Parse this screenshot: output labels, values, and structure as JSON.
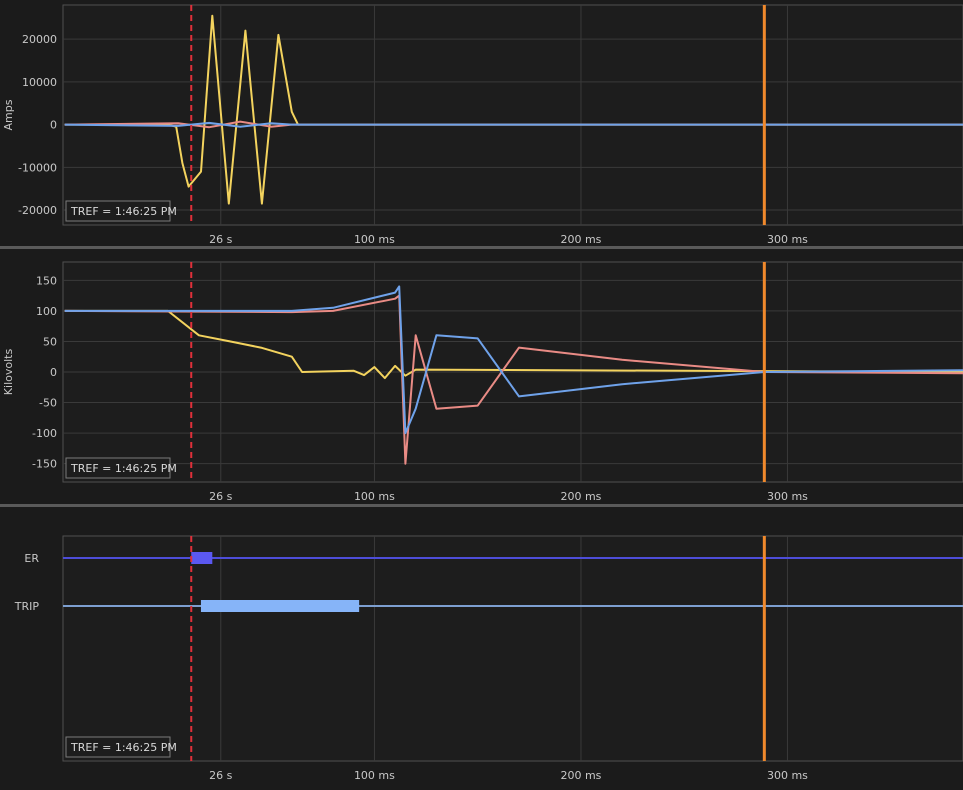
{
  "tref_label": "TREF = 1:46:25 PM",
  "colors": {
    "background": "#1b1b1b",
    "phase_a": "#f3d35e",
    "phase_b": "#e98b85",
    "phase_c": "#6fa2ea",
    "cursor_dashed": "#e0303a",
    "cursor_solid": "#f0892c",
    "digital_er": "#5b58f0",
    "digital_trip": "#86b4f8",
    "digital_line_er": "#4d4dd8",
    "digital_line_trip": "#7d9fd0"
  },
  "x_ticks": [
    {
      "t": 0.0256,
      "label": "26 s"
    },
    {
      "t": 0.1,
      "label": "100 ms"
    },
    {
      "t": 0.2,
      "label": "200 ms"
    },
    {
      "t": 0.3,
      "label": "300 ms"
    }
  ],
  "x_range": [
    -0.0508,
    0.385
  ],
  "cursors": {
    "dashed_t": 0.0113,
    "solid_t": 0.2888
  },
  "chart_data": [
    {
      "type": "line",
      "ylabel": "Amps",
      "ylim": [
        -23500,
        28000
      ],
      "yticks": [
        20000,
        10000,
        0,
        -10000,
        -20000
      ],
      "grid": true,
      "series": [
        {
          "color": "#f3d35e",
          "points": [
            [
              -0.05,
              0
            ],
            [
              0.0,
              0
            ],
            [
              0.004,
              -500
            ],
            [
              0.007,
              -9000
            ],
            [
              0.01,
              -14500
            ],
            [
              0.016,
              -11000
            ],
            [
              0.0215,
              25500
            ],
            [
              0.0295,
              -18500
            ],
            [
              0.0375,
              22000
            ],
            [
              0.0455,
              -18500
            ],
            [
              0.0535,
              21000
            ],
            [
              0.06,
              3000
            ],
            [
              0.063,
              0
            ],
            [
              0.385,
              0
            ]
          ]
        },
        {
          "color": "#e98b85",
          "points": [
            [
              -0.05,
              0
            ],
            [
              0.005,
              300
            ],
            [
              0.02,
              -600
            ],
            [
              0.035,
              700
            ],
            [
              0.05,
              -500
            ],
            [
              0.06,
              0
            ],
            [
              0.385,
              0
            ]
          ]
        },
        {
          "color": "#6fa2ea",
          "points": [
            [
              -0.05,
              0
            ],
            [
              0.005,
              -300
            ],
            [
              0.02,
              400
            ],
            [
              0.035,
              -500
            ],
            [
              0.05,
              300
            ],
            [
              0.06,
              0
            ],
            [
              0.385,
              0
            ]
          ]
        }
      ]
    },
    {
      "type": "line",
      "ylabel": "Kilovolts",
      "ylim": [
        -180,
        180
      ],
      "yticks": [
        150,
        100,
        50,
        0,
        -50,
        -100,
        -150
      ],
      "grid": true,
      "series": [
        {
          "color": "#f3d35e",
          "points": [
            [
              -0.05,
              100
            ],
            [
              0.0,
              100
            ],
            [
              0.015,
              60
            ],
            [
              0.03,
              50
            ],
            [
              0.045,
              40
            ],
            [
              0.06,
              25
            ],
            [
              0.065,
              0
            ],
            [
              0.09,
              2
            ],
            [
              0.095,
              -5
            ],
            [
              0.1,
              8
            ],
            [
              0.105,
              -10
            ],
            [
              0.11,
              10
            ],
            [
              0.115,
              -6
            ],
            [
              0.12,
              4
            ],
            [
              0.385,
              0
            ]
          ]
        },
        {
          "color": "#e98b85",
          "points": [
            [
              -0.05,
              100
            ],
            [
              0.06,
              98
            ],
            [
              0.08,
              100
            ],
            [
              0.11,
              120
            ],
            [
              0.112,
              125
            ],
            [
              0.115,
              -150
            ],
            [
              0.12,
              60
            ],
            [
              0.13,
              -60
            ],
            [
              0.15,
              -55
            ],
            [
              0.17,
              40
            ],
            [
              0.22,
              20
            ],
            [
              0.289,
              0
            ],
            [
              0.385,
              -2
            ]
          ]
        },
        {
          "color": "#6fa2ea",
          "points": [
            [
              -0.05,
              100
            ],
            [
              0.06,
              100
            ],
            [
              0.08,
              105
            ],
            [
              0.11,
              130
            ],
            [
              0.112,
              140
            ],
            [
              0.115,
              -100
            ],
            [
              0.12,
              -60
            ],
            [
              0.13,
              60
            ],
            [
              0.15,
              55
            ],
            [
              0.17,
              -40
            ],
            [
              0.22,
              -20
            ],
            [
              0.289,
              0
            ],
            [
              0.385,
              3
            ]
          ]
        }
      ]
    },
    {
      "type": "digital",
      "channels": [
        {
          "label": "ER",
          "color": "#5b58f0",
          "line_color": "#4d4dd8",
          "on": [
            [
              0.0113,
              0.0215
            ]
          ]
        },
        {
          "label": "TRIP",
          "color": "#86b4f8",
          "line_color": "#7d9fd0",
          "on": [
            [
              0.016,
              0.0926
            ]
          ]
        }
      ]
    }
  ]
}
